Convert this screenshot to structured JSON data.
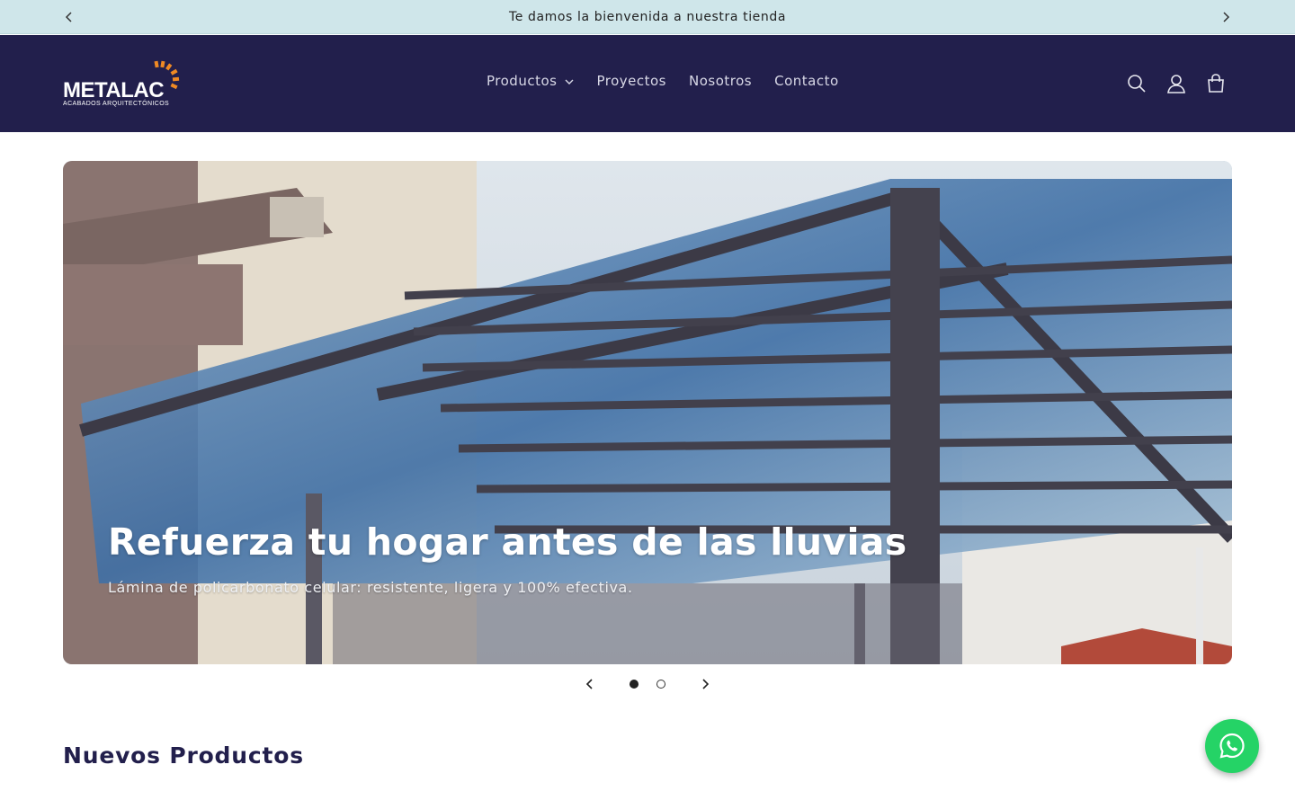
{
  "announcement": {
    "text": "Te damos la bienvenida a nuestra tienda",
    "prev_icon": "chevron-left-icon",
    "next_icon": "chevron-right-icon"
  },
  "header": {
    "logo": {
      "wordmark": "METALAC",
      "tagline": "ACABADOS ARQUITECTÓNICOS"
    },
    "nav": [
      {
        "label": "Productos",
        "has_dropdown": true
      },
      {
        "label": "Proyectos"
      },
      {
        "label": "Nosotros"
      },
      {
        "label": "Contacto"
      }
    ],
    "icons": [
      "search-icon",
      "account-icon",
      "cart-icon"
    ]
  },
  "hero": {
    "title": "Refuerza tu hogar antes de las lluvias",
    "subtitle": "Lámina de policarbonato celular: resistente, ligera y 100% efectiva.",
    "slide_count": 2,
    "active_slide": 1
  },
  "sections": {
    "new_products_title": "Nuevos Productos"
  },
  "floating": {
    "icon": "whatsapp-icon"
  },
  "colors": {
    "announcement_bg": "#cfe6ea",
    "header_bg": "#221f4c",
    "brand_orange": "#f08a24",
    "whatsapp_green": "#25d366"
  }
}
